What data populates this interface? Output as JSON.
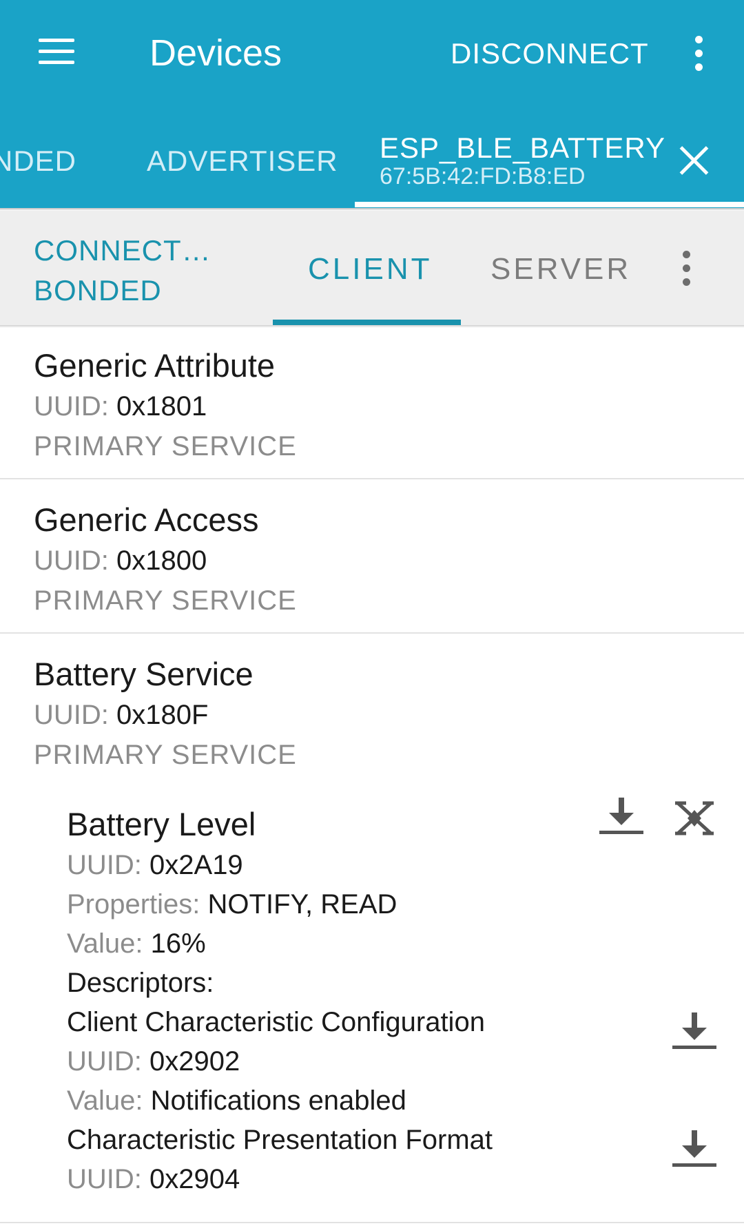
{
  "appbar": {
    "title": "Devices",
    "disconnect_label": "DISCONNECT"
  },
  "tabs": {
    "bonded_partial": "NDED",
    "advertiser": "ADVERTISER",
    "device_name": "ESP_BLE_BATTERY",
    "device_address": "67:5B:42:FD:B8:ED"
  },
  "subbar": {
    "status_connection": "CONNECT…",
    "status_bond": "BONDED",
    "tab_client": "CLIENT",
    "tab_server": "SERVER"
  },
  "services": [
    {
      "name": "Generic Attribute",
      "uuid_label": "UUID:",
      "uuid": "0x1801",
      "type": "PRIMARY SERVICE"
    },
    {
      "name": "Generic Access",
      "uuid_label": "UUID:",
      "uuid": "0x1800",
      "type": "PRIMARY SERVICE"
    },
    {
      "name": "Battery Service",
      "uuid_label": "UUID:",
      "uuid": "0x180F",
      "type": "PRIMARY SERVICE"
    }
  ],
  "characteristic": {
    "name": "Battery Level",
    "uuid_label": "UUID:",
    "uuid": "0x2A19",
    "properties_label": "Properties:",
    "properties": "NOTIFY, READ",
    "value_label": "Value:",
    "value": "16%",
    "descriptors_heading": "Descriptors:",
    "descriptors": [
      {
        "name": "Client Characteristic Configuration",
        "uuid_label": "UUID:",
        "uuid": "0x2902",
        "value_label": "Value:",
        "value": "Notifications enabled"
      },
      {
        "name": "Characteristic Presentation Format",
        "uuid_label": "UUID:",
        "uuid": "0x2904"
      }
    ]
  },
  "icons": {
    "menu": "hamburger-menu-icon",
    "more": "more-vert-icon",
    "close": "close-icon",
    "read": "download-icon",
    "notify": "notifications-off-icon"
  },
  "colors": {
    "appbar": "#1aa3c7",
    "accent": "#1992ad",
    "subbar": "#eeeeee"
  }
}
